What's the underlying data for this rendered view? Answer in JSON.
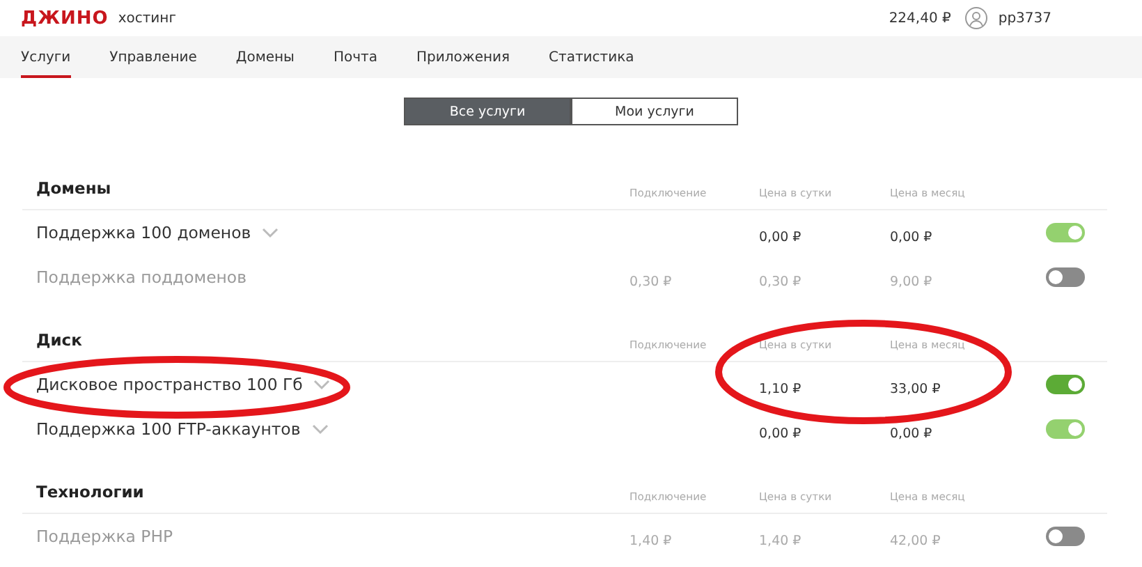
{
  "header": {
    "logo": "ДЖИНО",
    "logo_sub": "хостинг",
    "balance": "224,40 ₽",
    "username": "pp3737"
  },
  "tabs": [
    {
      "label": "Услуги",
      "selected": true
    },
    {
      "label": "Управление",
      "selected": false
    },
    {
      "label": "Домены",
      "selected": false
    },
    {
      "label": "Почта",
      "selected": false
    },
    {
      "label": "Приложения",
      "selected": false
    },
    {
      "label": "Статистика",
      "selected": false
    }
  ],
  "filter": [
    {
      "label": "Все услуги",
      "selected": true
    },
    {
      "label": "Мои услуги",
      "selected": false
    }
  ],
  "sections": [
    {
      "title": "Домены",
      "columns": [
        "Подключение",
        "Цена в сутки",
        "Цена в месяц"
      ],
      "rows": [
        {
          "name": "Поддержка 100 доменов",
          "expandable": true,
          "on": true,
          "color": "#94d16f",
          "day": "0,00 ₽",
          "month": "0,00 ₽"
        },
        {
          "name": "Поддержка поддоменов",
          "expandable": false,
          "on": false,
          "connect": "0,30 ₽",
          "day": "0,30 ₽",
          "month": "9,00 ₽"
        }
      ]
    },
    {
      "title": "Диск",
      "columns": [
        "Подключение",
        "Цена в сутки",
        "Цена в месяц"
      ],
      "rows": [
        {
          "name": "Дисковое пространство 100 Гб",
          "expandable": true,
          "on": true,
          "color": "#5cab36",
          "day": "1,10 ₽",
          "month": "33,00 ₽"
        },
        {
          "name": "Поддержка 100 FTP-аккаунтов",
          "expandable": true,
          "on": true,
          "color": "#94d16f",
          "day": "0,00 ₽",
          "month": "0,00 ₽"
        }
      ]
    },
    {
      "title": "Технологии",
      "columns": [
        "Подключение",
        "Цена в сутки",
        "Цена в месяц"
      ],
      "rows": [
        {
          "name": "Поддержка PHP",
          "expandable": false,
          "on": false,
          "connect": "1,40 ₽",
          "day": "1,40 ₽",
          "month": "42,00 ₽"
        }
      ]
    }
  ]
}
